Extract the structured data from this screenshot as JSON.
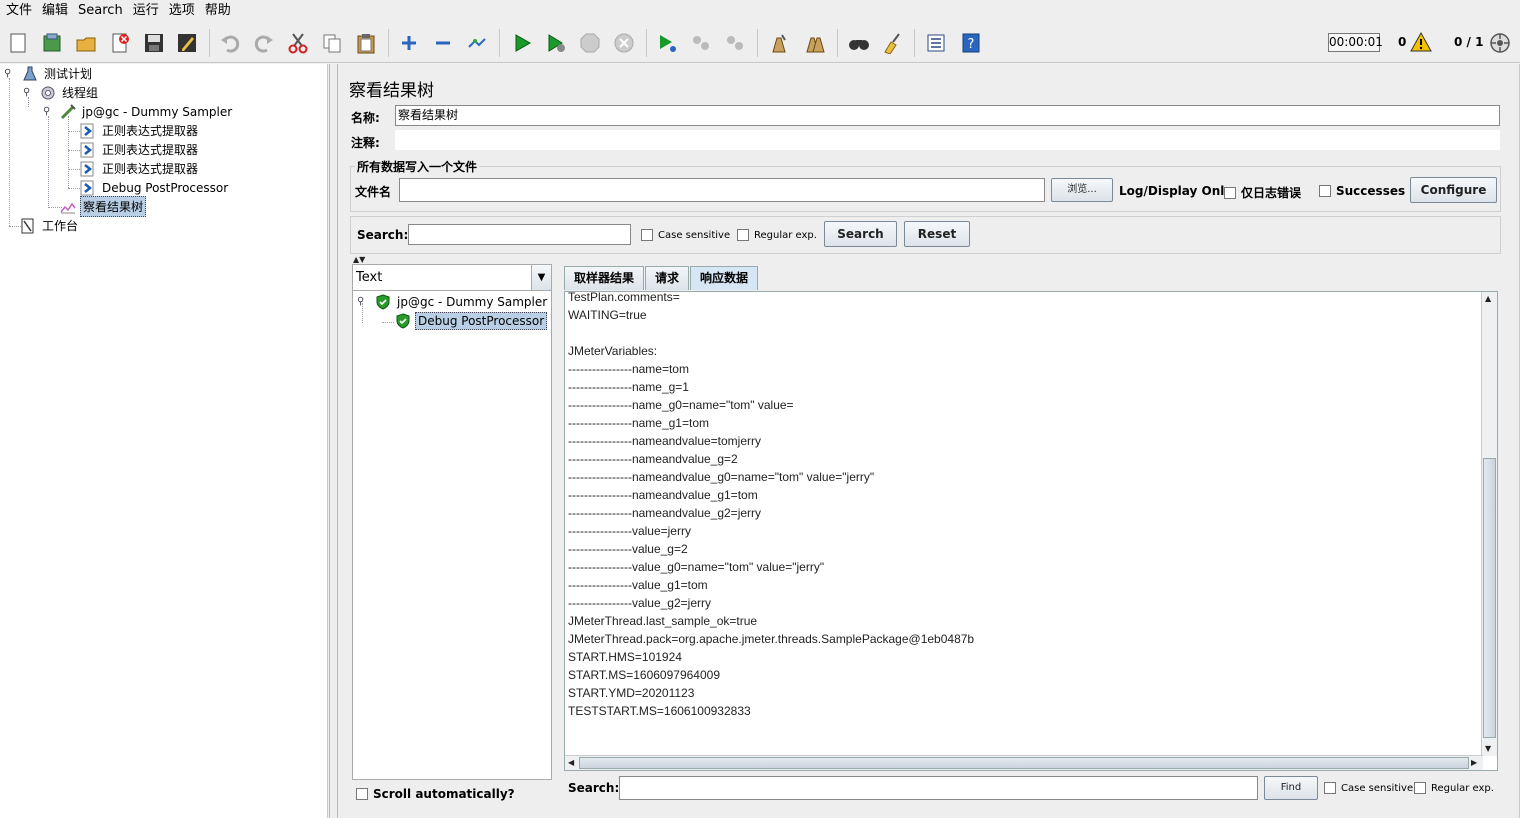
{
  "menu": [
    "文件",
    "编辑",
    "Search",
    "运行",
    "选项",
    "帮助"
  ],
  "toolbar": {
    "timer": "00:00:01",
    "error_count": "0",
    "thread_count": "0 / 1"
  },
  "tree": {
    "items": [
      {
        "label": "测试计划",
        "icon": "test-plan-icon"
      },
      {
        "label": "线程组",
        "icon": "thread-group-icon"
      },
      {
        "label": "jp@gc - Dummy Sampler",
        "icon": "sampler-icon"
      },
      {
        "label": "正则表达式提取器",
        "icon": "extractor-icon"
      },
      {
        "label": "正则表达式提取器",
        "icon": "extractor-icon"
      },
      {
        "label": "正则表达式提取器",
        "icon": "extractor-icon"
      },
      {
        "label": "Debug PostProcessor",
        "icon": "extractor-icon"
      },
      {
        "label": "察看结果树",
        "icon": "listener-icon"
      },
      {
        "label": "工作台",
        "icon": "workbench-icon"
      }
    ]
  },
  "panel": {
    "title": "察看结果树",
    "name_label": "名称:",
    "name_value": "察看结果树",
    "comment_label": "注释:",
    "file_group_title": "所有数据写入一个文件",
    "filename_label": "文件名",
    "browse_label": "浏览...",
    "log_display_label": "Log/Display Only:",
    "errors_only_label": "仅日志错误",
    "successes_label": "Successes",
    "configure_label": "Configure",
    "search_label": "Search:",
    "case_sensitive_label": "Case sensitive",
    "regex_label": "Regular exp.",
    "search_button": "Search",
    "reset_button": "Reset"
  },
  "results": {
    "renderer": "Text",
    "samples": [
      {
        "label": "jp@gc - Dummy Sampler",
        "status": "success"
      },
      {
        "label": "Debug PostProcessor",
        "status": "success"
      }
    ],
    "scroll_auto_label": "Scroll automatically?",
    "tabs": [
      "取样器结果",
      "请求",
      "响应数据"
    ],
    "active_tab": "响应数据",
    "response_lines": [
      "TestPlan.comments=",
      "WAITING=true",
      "",
      "JMeterVariables:",
      "----------------name=tom",
      "----------------name_g=1",
      "----------------name_g0=name=\"tom\" value=",
      "----------------name_g1=tom",
      "----------------nameandvalue=tomjerry",
      "----------------nameandvalue_g=2",
      "----------------nameandvalue_g0=name=\"tom\" value=\"jerry\"",
      "----------------nameandvalue_g1=tom",
      "----------------nameandvalue_g2=jerry",
      "----------------value=jerry",
      "----------------value_g=2",
      "----------------value_g0=name=\"tom\" value=\"jerry\"",
      "----------------value_g1=tom",
      "----------------value_g2=jerry",
      "JMeterThread.last_sample_ok=true",
      "JMeterThread.pack=org.apache.jmeter.threads.SamplePackage@1eb0487b",
      "START.HMS=101924",
      "START.MS=1606097964009",
      "START.YMD=20201123",
      "TESTSTART.MS=1606100932833"
    ],
    "find_label": "Search:",
    "find_button": "Find",
    "find_case_label": "Case sensitive",
    "find_regex_label": "Regular exp."
  }
}
